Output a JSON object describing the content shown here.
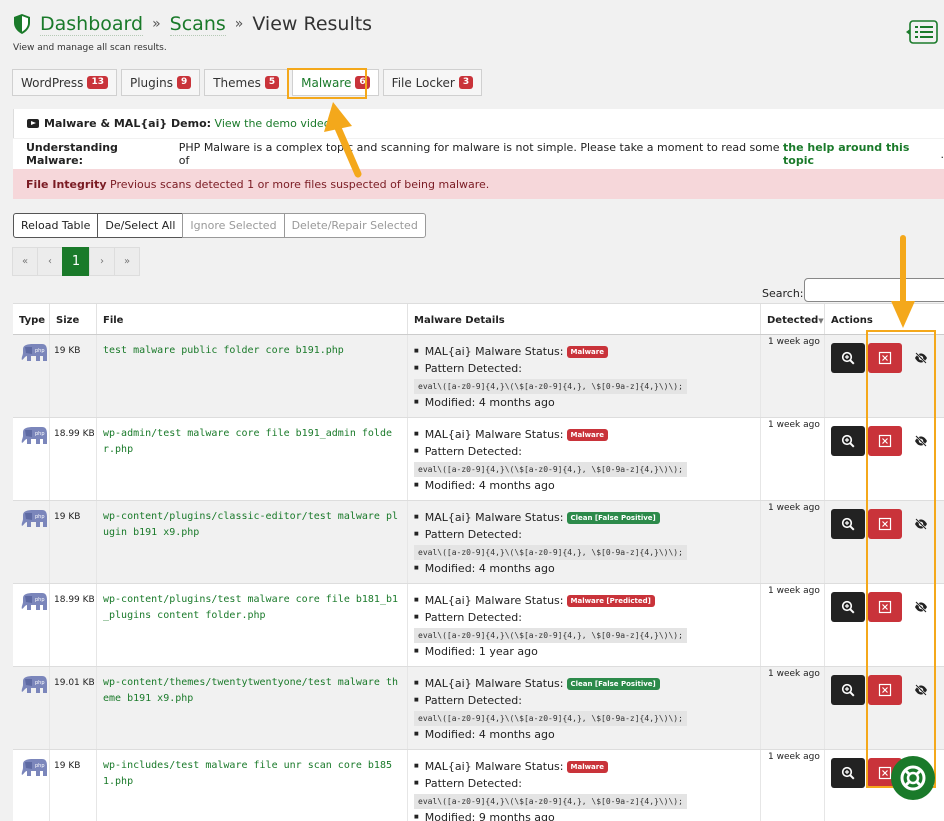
{
  "breadcrumb": {
    "home": "Dashboard",
    "section": "Scans",
    "current": "View Results",
    "sep": "»"
  },
  "subtitle": "View and manage all scan results.",
  "tabs": [
    {
      "label": "WordPress",
      "count": "13"
    },
    {
      "label": "Plugins",
      "count": "9"
    },
    {
      "label": "Themes",
      "count": "5"
    },
    {
      "label": "Malware",
      "count": "6"
    },
    {
      "label": "File Locker",
      "count": "3"
    }
  ],
  "notices": {
    "demo_title": "Malware & MAL{ai} Demo:",
    "demo_link": "View the demo video.",
    "understanding_title": "Understanding Malware:",
    "understanding_text": "PHP Malware is a complex topic and scanning for malware is not simple. Please take a moment to read some of",
    "understanding_link": "the help around this topic",
    "understanding_end": ".",
    "integrity_title": "File Integrity",
    "integrity_text": "Previous scans detected 1 or more files suspected of being malware."
  },
  "actions": {
    "reload": "Reload Table",
    "deselect": "De/Select All",
    "ignore": "Ignore Selected",
    "delete": "Delete/Repair Selected"
  },
  "pager": {
    "first": "«",
    "prev": "‹",
    "current": "1",
    "next": "›",
    "last": "»"
  },
  "search": {
    "label": "Search:",
    "value": ""
  },
  "table": {
    "headers": {
      "type": "Type",
      "size": "Size",
      "file": "File",
      "details": "Malware Details",
      "detected": "Detected",
      "actions": "Actions"
    },
    "labels": {
      "status": "MAL{ai} Malware Status:",
      "pattern": "Pattern Detected:"
    },
    "rows": [
      {
        "size": "19 KB",
        "file": "test malware public folder core b191.php",
        "status": "Malware",
        "status_color": "#c9333a",
        "pattern": "eval\\([a-z0-9]{4,}\\(\\$[a-z0-9]{4,}, \\$[0-9a-z]{4,}\\)\\);",
        "modified": "Modified: 4 months ago",
        "detected": "1 week ago"
      },
      {
        "size": "18.99 KB",
        "file": "wp-admin/test malware core file b191_admin folder.php",
        "status": "Malware",
        "status_color": "#c9333a",
        "pattern": "eval\\([a-z0-9]{4,}\\(\\$[a-z0-9]{4,}, \\$[0-9a-z]{4,}\\)\\);",
        "modified": "Modified: 4 months ago",
        "detected": "1 week ago"
      },
      {
        "size": "19 KB",
        "file": "wp-content/plugins/classic-editor/test malware plugin b191 x9.php",
        "status": "Clean [False Positive]",
        "status_color": "#2c8a4a",
        "pattern": "eval\\([a-z0-9]{4,}\\(\\$[a-z0-9]{4,}, \\$[0-9a-z]{4,}\\)\\);",
        "modified": "Modified: 4 months ago",
        "detected": "1 week ago"
      },
      {
        "size": "18.99 KB",
        "file": "wp-content/plugins/test malware core file b181_b1_plugins content folder.php",
        "status": "Malware [Predicted]",
        "status_color": "#c9333a",
        "pattern": "eval\\([a-z0-9]{4,}\\(\\$[a-z0-9]{4,}, \\$[0-9a-z]{4,}\\)\\);",
        "modified": "Modified: 1 year ago",
        "detected": "1 week ago"
      },
      {
        "size": "19.01 KB",
        "file": "wp-content/themes/twentytwentyone/test malware theme b191 x9.php",
        "status": "Clean [False Positive]",
        "status_color": "#2c8a4a",
        "pattern": "eval\\([a-z0-9]{4,}\\(\\$[a-z0-9]{4,}, \\$[0-9a-z]{4,}\\)\\);",
        "modified": "Modified: 4 months ago",
        "detected": "1 week ago"
      },
      {
        "size": "19 KB",
        "file": "wp-includes/test malware file unr scan core b1851.php",
        "status": "Malware",
        "status_color": "#c9333a",
        "pattern": "eval\\([a-z0-9]{4,}\\(\\$[a-z0-9]{4,}, \\$[0-9a-z]{4,}\\)\\);",
        "modified": "Modified: 9 months ago",
        "detected": "1 week ago"
      }
    ]
  },
  "colors": {
    "accent": "#1a7a2a",
    "danger": "#c9333a",
    "highlight": "#f4a81b"
  }
}
